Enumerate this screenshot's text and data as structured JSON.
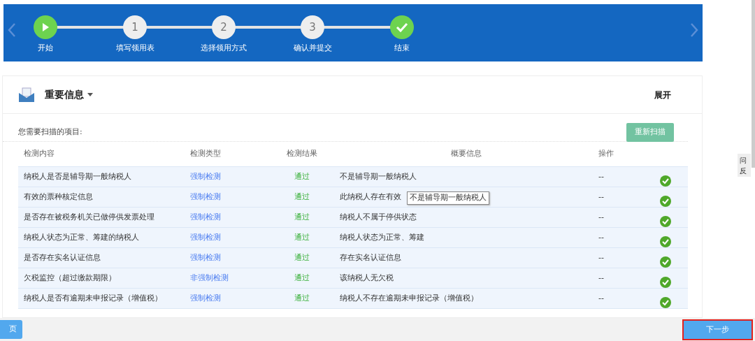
{
  "steps": [
    {
      "label": "开始",
      "kind": "current"
    },
    {
      "label": "填写领用表",
      "kind": "pending",
      "number": "1"
    },
    {
      "label": "选择领用方式",
      "kind": "pending",
      "number": "2"
    },
    {
      "label": "确认并提交",
      "kind": "pending",
      "number": "3"
    },
    {
      "label": "结束",
      "kind": "done"
    }
  ],
  "panel": {
    "title": "重要信息",
    "toggle": "展开",
    "scan_label": "您需要扫描的项目:",
    "rescan_button": "重新扫描"
  },
  "table": {
    "columns": [
      "检测内容",
      "检测类型",
      "检测结果",
      "概要信息",
      "操作"
    ],
    "rows": [
      {
        "content": "纳税人是否是辅导期一般纳税人",
        "type": "强制检测",
        "result": "通过",
        "summary": "不是辅导期一般纳税人",
        "action": "--",
        "passed": true
      },
      {
        "content": "有效的票种核定信息",
        "type": "强制检测",
        "result": "通过",
        "summary": "此纳税人存在有效",
        "action": "--",
        "passed": true
      },
      {
        "content": "是否存在被税务机关已做停供发票处理",
        "type": "强制检测",
        "result": "通过",
        "summary": "纳税人不属于停供状态",
        "action": "--",
        "passed": true
      },
      {
        "content": "纳税人状态为正常、筹建的纳税人",
        "type": "强制检测",
        "result": "通过",
        "summary": "纳税人状态为正常、筹建",
        "action": "--",
        "passed": true
      },
      {
        "content": "是否存在实名认证信息",
        "type": "强制检测",
        "result": "通过",
        "summary": "存在实名认证信息",
        "action": "--",
        "passed": true
      },
      {
        "content": "欠税监控（超过缴款期限）",
        "type": "非强制检测",
        "result": "通过",
        "summary": "该纳税人无欠税",
        "action": "--",
        "passed": true
      },
      {
        "content": "纳税人是否有逾期未申报记录（增值税）",
        "type": "强制检测",
        "result": "通过",
        "summary": "纳税人不存在逾期未申报记录（增值税）",
        "action": "--",
        "passed": true
      }
    ]
  },
  "tooltip": "不是辅导期一般纳税人",
  "feedback_tab": [
    "问",
    "反"
  ],
  "footer": {
    "prev_button": "页",
    "next_button": "下一步"
  }
}
